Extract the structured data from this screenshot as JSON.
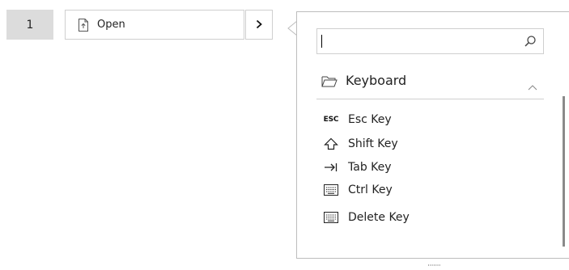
{
  "step": {
    "number": "1"
  },
  "action": {
    "icon": "document-upload-icon",
    "label": "Open",
    "expand_icon": "chevron-right-icon"
  },
  "panel": {
    "search": {
      "value": "",
      "placeholder": "",
      "icon": "search-icon"
    },
    "category": {
      "icon": "folder-icon",
      "label": "Keyboard",
      "toggle_icon": "chevron-up-icon",
      "expanded": true
    },
    "items": [
      {
        "icon": "esc-icon",
        "glyph": "ESC",
        "label": "Esc Key"
      },
      {
        "icon": "shift-arrow-icon",
        "label": "Shift Key"
      },
      {
        "icon": "tab-arrow-icon",
        "label": "Tab Key"
      },
      {
        "icon": "keyboard-icon",
        "label": "Ctrl Key"
      },
      {
        "icon": "keyboard-icon",
        "label": "Delete Key"
      }
    ]
  },
  "colors": {
    "step_bg": "#dcdcdc",
    "border": "#cfcfcf",
    "scrollbar": "#8a8a8a"
  }
}
